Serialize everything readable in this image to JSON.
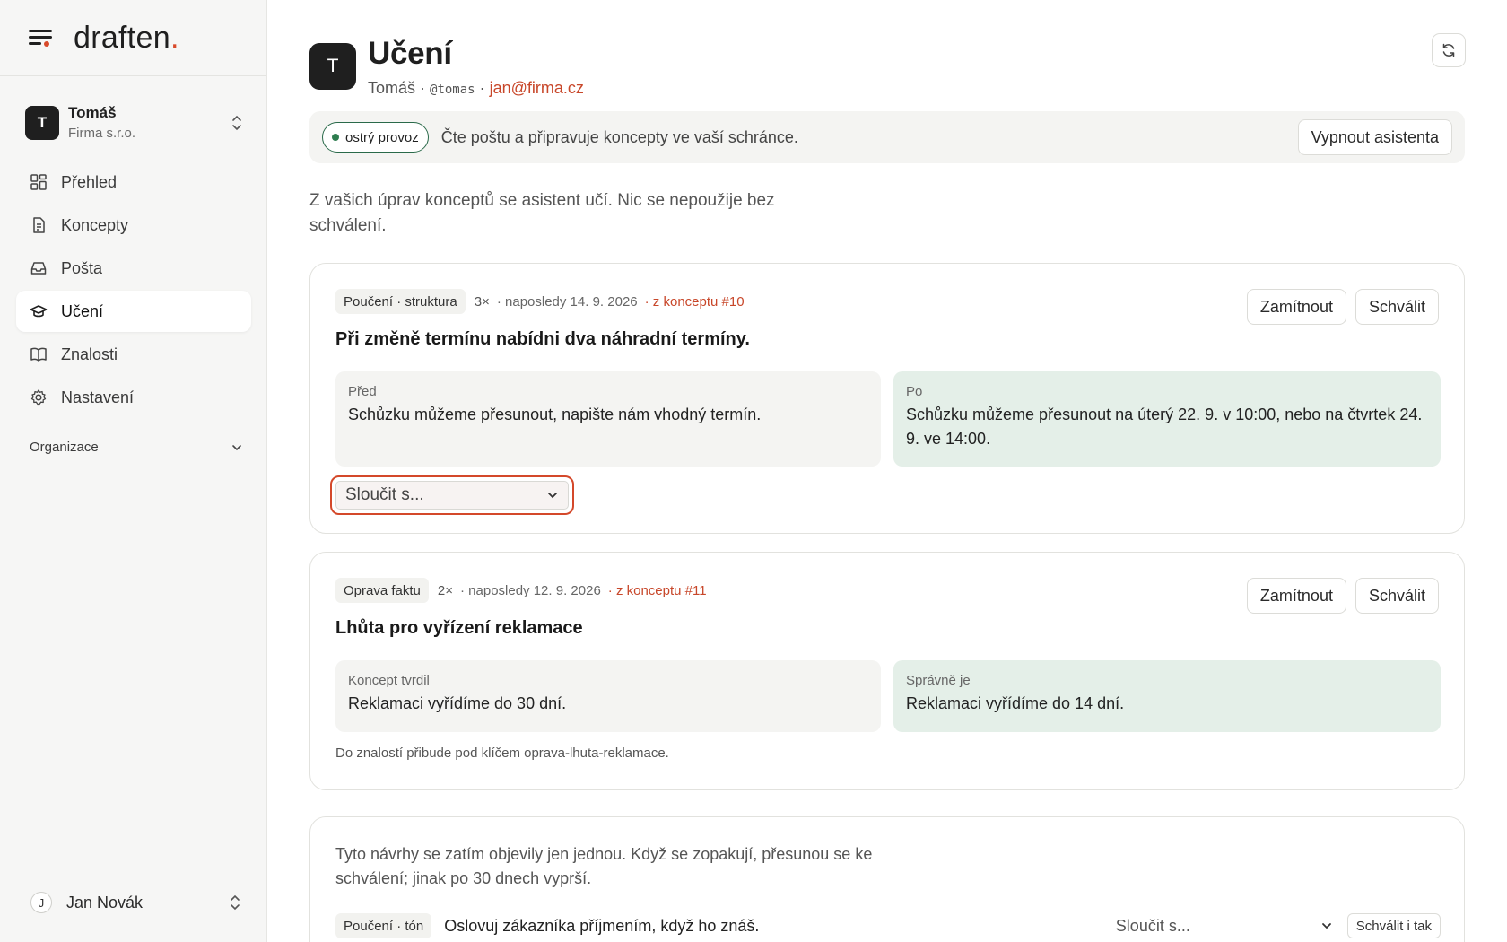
{
  "sidebar": {
    "logo_text": "draften",
    "logo_dot": ".",
    "account": {
      "initial": "T",
      "name": "Tomáš",
      "org": "Firma s.r.o."
    },
    "nav": [
      {
        "label": "Přehled",
        "icon": "grid-icon"
      },
      {
        "label": "Koncepty",
        "icon": "document-icon"
      },
      {
        "label": "Pošta",
        "icon": "inbox-icon"
      },
      {
        "label": "Učení",
        "icon": "graduation-cap-icon",
        "active": true
      },
      {
        "label": "Znalosti",
        "icon": "book-icon"
      },
      {
        "label": "Nastavení",
        "icon": "gear-icon"
      }
    ],
    "organization_label": "Organizace",
    "user": {
      "initial": "J",
      "name": "Jan Novák"
    }
  },
  "header": {
    "initial": "T",
    "title": "Učení",
    "name": "Tomáš",
    "sep1": " · ",
    "handle": "@tomas",
    "sep2": " · ",
    "email": "jan@firma.cz"
  },
  "status": {
    "pill_label": "ostrý provoz",
    "text": "Čte poštu a připravuje koncepty ve vaší schránce.",
    "off_button": "Vypnout asistenta"
  },
  "intro": "Z vašich úprav konceptů se asistent učí. Nic se nepoužije bez schválení.",
  "cards": [
    {
      "tag": "Poučení · struktura",
      "count": "3×",
      "last": "· naposledy 14. 9. 2026",
      "source": "· z konceptu #10",
      "reject": "Zamítnout",
      "approve": "Schválit",
      "title": "Při změně termínu nabídni dva náhradní termíny.",
      "before_label": "Před",
      "before_text": "Schůzku můžeme přesunout, napište nám vhodný termín.",
      "after_label": "Po",
      "after_text": "Schůzku můžeme přesunout na úterý 22. 9. v 10:00, nebo na čtvrtek 24. 9. ve 14:00.",
      "merge_placeholder": "Sloučit s..."
    },
    {
      "tag": "Oprava faktu",
      "count": "2×",
      "last": "· naposledy 12. 9. 2026",
      "source": "· z konceptu #11",
      "reject": "Zamítnout",
      "approve": "Schválit",
      "title": "Lhůta pro vyřízení reklamace",
      "before_label": "Koncept tvrdil",
      "before_text": "Reklamaci vyřídíme do 30 dní.",
      "after_label": "Správně je",
      "after_text": "Reklamaci vyřídíme do 14 dní.",
      "note": "Do znalostí přibude pod klíčem oprava-lhuta-reklamace."
    }
  ],
  "pending": {
    "text": "Tyto návrhy se zatím objevily jen jednou. Když se zopakují, přesunou se ke schválení; jinak po 30 dnech vyprší.",
    "tag": "Poučení · tón",
    "item_text": "Oslovuj zákazníka příjmením, když ho znáš.",
    "merge_placeholder": "Sloučit s...",
    "approve_anyway": "Schválit i tak"
  },
  "colors": {
    "accent": "#d84a2b",
    "live_green": "#2e7d4f",
    "after_pane": "#e4efe8",
    "sidebar_bg": "#f6f6f5"
  }
}
